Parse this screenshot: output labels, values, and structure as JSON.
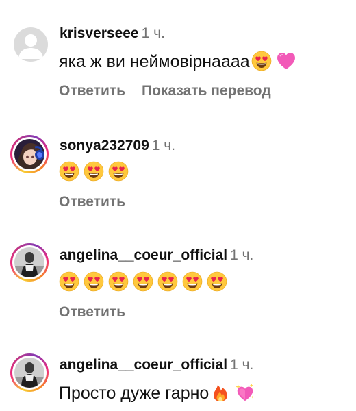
{
  "colors": {
    "text": "#111111",
    "secondary": "#737373",
    "emoji_face": "#FFC83D",
    "emoji_heart": "#E8244B",
    "pink_heart": "#F25AB8"
  },
  "comments": [
    {
      "username": "krisverseee",
      "time": "1 ч.",
      "text": "яка ж ви неймовірнаааа",
      "emojis": [
        "heart-eyes-face-icon",
        "pink-heart-icon"
      ],
      "actions": [
        "Ответить",
        "Показать перевод"
      ]
    },
    {
      "username": "sonya232709",
      "time": "1 ч.",
      "text": "",
      "emojis": [
        "heart-eyes-face-icon",
        "heart-eyes-face-icon",
        "heart-eyes-face-icon"
      ],
      "actions": [
        "Ответить"
      ]
    },
    {
      "username": "angelina__coeur_official",
      "time": "1 ч.",
      "text": "",
      "emojis": [
        "heart-eyes-face-icon",
        "heart-eyes-face-icon",
        "heart-eyes-face-icon",
        "heart-eyes-face-icon",
        "heart-eyes-face-icon",
        "heart-eyes-face-icon",
        "heart-eyes-face-icon"
      ],
      "actions": [
        "Ответить"
      ]
    },
    {
      "username": "angelina__coeur_official",
      "time": "1 ч.",
      "text": "Просто дуже гарно",
      "emojis": [
        "fire-icon",
        "sparkling-heart-icon"
      ],
      "actions": []
    }
  ]
}
